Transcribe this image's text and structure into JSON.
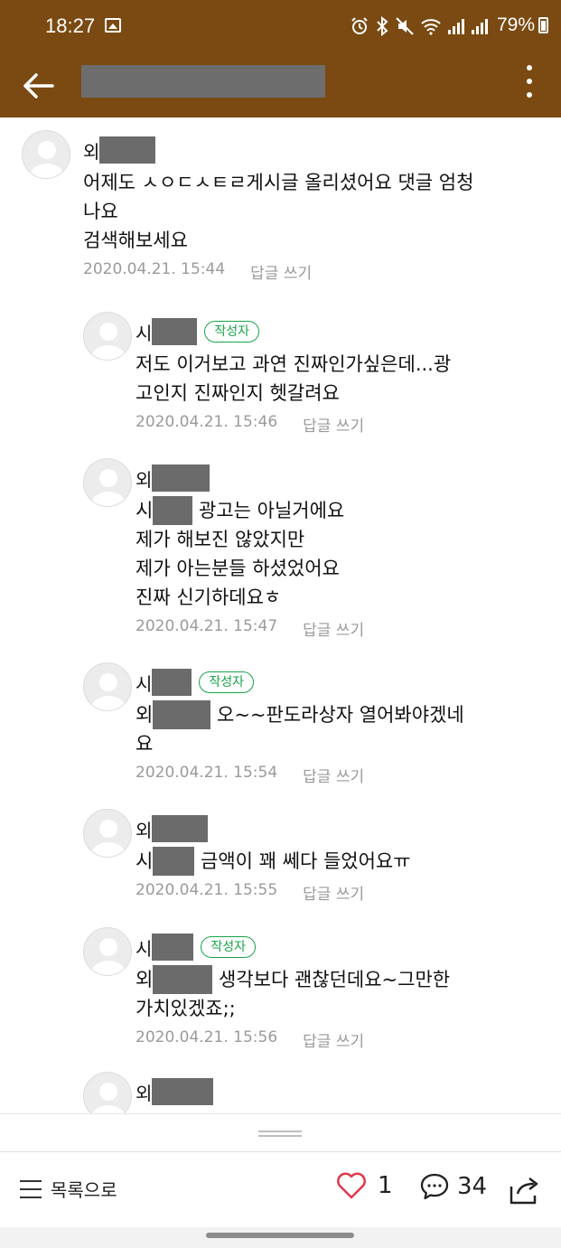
{
  "status_bar": {
    "time": "18:27",
    "battery": "79%",
    "icons": [
      "image-icon",
      "alarm-icon",
      "bluetooth-icon",
      "mute-icon",
      "wifi-icon",
      "signal-icon",
      "signal-icon",
      "battery-icon"
    ]
  },
  "app_bar": {
    "back_icon": "back-arrow-icon",
    "more_icon": "more-vert-icon"
  },
  "comments": [
    {
      "nick_prefix": "외",
      "is_author": false,
      "mention_prefix": "",
      "text": "어제도 ㅅㅇㄷㅅㅌㄹ게시글 올리셨어요 댓글 엄청\n나요\n검색해보세요",
      "date": "2020.04.21. 15:44",
      "reply": "답글 쓰기"
    },
    {
      "nick_prefix": "시",
      "is_author": true,
      "mention_prefix": "",
      "text": "저도 이거보고 과연 진짜인가싶은데...광\n고인지 진짜인지 헷갈려요",
      "date": "2020.04.21. 15:46",
      "reply": "답글 쓰기"
    },
    {
      "nick_prefix": "외",
      "is_author": false,
      "mention_prefix": "시",
      "text": " 광고는 아닐거에요\n제가 해보진 않았지만\n제가 아는분들 하셨었어요\n진짜 신기하데요ㅎ",
      "date": "2020.04.21. 15:47",
      "reply": "답글 쓰기"
    },
    {
      "nick_prefix": "시",
      "is_author": true,
      "mention_prefix": "외",
      "text": " 오~~판도라상자 열어봐야겠네\n요",
      "date": "2020.04.21. 15:54",
      "reply": "답글 쓰기"
    },
    {
      "nick_prefix": "외",
      "is_author": false,
      "mention_prefix": "시",
      "text": " 금액이 꽤 쎄다 들었어요ㅠ",
      "date": "2020.04.21. 15:55",
      "reply": "답글 쓰기"
    },
    {
      "nick_prefix": "시",
      "is_author": true,
      "mention_prefix": "외",
      "text": " 생각보다 괜찮던데요~그만한\n가치있겠죠;;",
      "date": "2020.04.21. 15:56",
      "reply": "답글 쓰기"
    },
    {
      "nick_prefix": "외",
      "is_author": false,
      "mention_prefix": "",
      "text": "",
      "date": "",
      "reply": ""
    }
  ],
  "author_badge": "작성자",
  "bottom_bar": {
    "list_label": "목록으로",
    "like_count": "1",
    "comment_count": "34",
    "icons": [
      "hamburger-icon",
      "heart-icon",
      "comment-bubble-icon",
      "share-icon"
    ]
  },
  "colors": {
    "app_bar": "#7a4a12",
    "author_badge": "#1aa34a",
    "like_heart": "#e0394a",
    "meta_text": "#9a9a9a"
  }
}
